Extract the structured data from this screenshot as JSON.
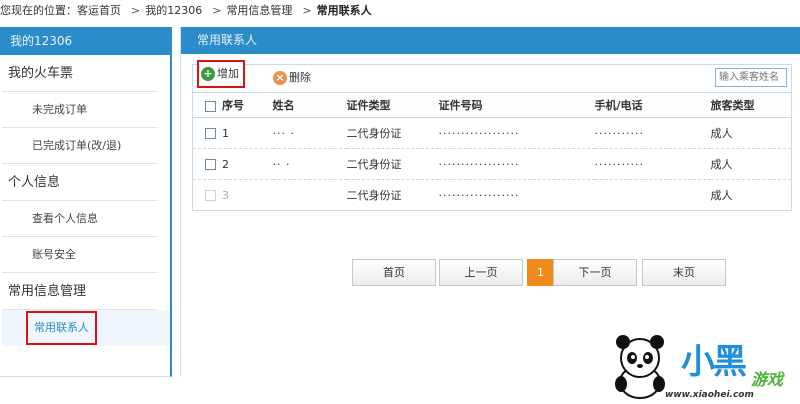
{
  "breadcrumb": {
    "prefix": "您现在的位置：客运首页",
    "items": [
      "我的12306",
      "常用信息管理"
    ],
    "current": "常用联系人",
    "separator": ">"
  },
  "sidebar": {
    "title": "我的12306",
    "groups": [
      {
        "label": "我的火车票",
        "items": [
          "未完成订单",
          "已完成订单(改/退)"
        ]
      },
      {
        "label": "个人信息",
        "items": [
          "查看个人信息",
          "账号安全"
        ]
      },
      {
        "label": "常用信息管理",
        "items": [
          "常用联系人"
        ]
      }
    ]
  },
  "main": {
    "title": "常用联系人",
    "toolbar": {
      "add_label": "增加",
      "delete_label": "删除",
      "search_placeholder": "输入乘客姓名"
    },
    "table": {
      "headers": [
        "序号",
        "姓名",
        "证件类型",
        "证件号码",
        "手机/电话",
        "旅客类型"
      ],
      "rows": [
        {
          "seq": "1",
          "name": "··· ·",
          "id_type": "二代身份证",
          "id_number": "··················",
          "phone": "···········",
          "passenger_type": "成人"
        },
        {
          "seq": "2",
          "name": "·· ·",
          "id_type": "二代身份证",
          "id_number": "··················",
          "phone": "···········",
          "passenger_type": "成人"
        },
        {
          "seq": "3",
          "name": "",
          "id_type": "二代身份证",
          "id_number": "··················",
          "phone": "",
          "passenger_type": "成人"
        }
      ]
    },
    "pager": {
      "first": "首页",
      "prev": "上一页",
      "current_page": "1",
      "next": "下一页",
      "last": "末页"
    }
  },
  "watermark": {
    "big_text": "小黑",
    "game_text": "游戏",
    "url": "www.xiaohei.com"
  },
  "colors": {
    "brand_blue": "#2a8cc8",
    "highlight_red": "#dd1111",
    "page_orange": "#f08a1c"
  }
}
